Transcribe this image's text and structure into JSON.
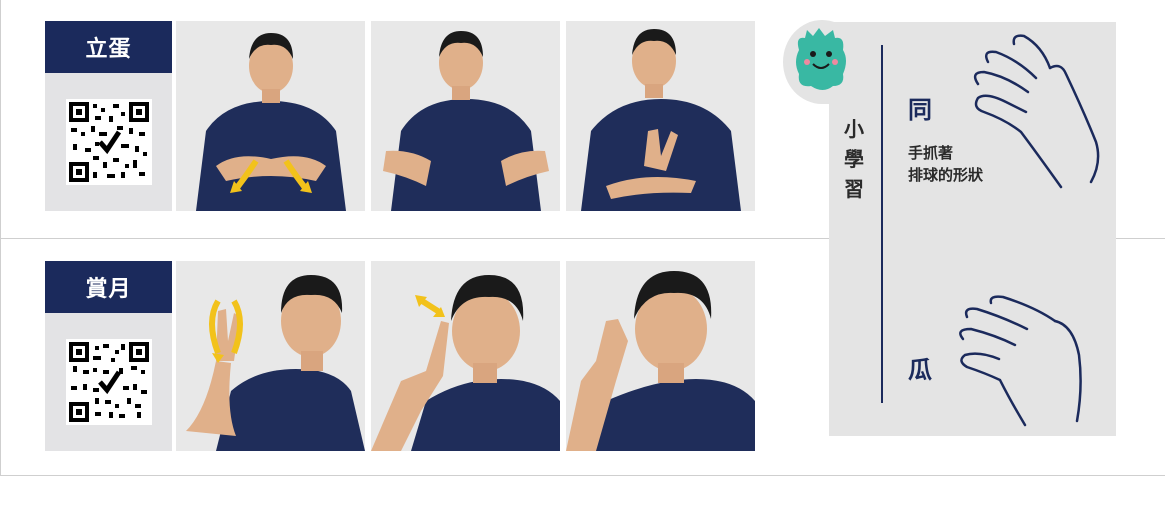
{
  "rows": [
    {
      "label": "立蛋"
    },
    {
      "label": "賞月"
    }
  ],
  "learn": {
    "title_chars": [
      "小",
      "學",
      "習"
    ],
    "item1_char": "同",
    "item1_desc_line1": "手抓著",
    "item1_desc_line2": "排球的形狀",
    "item2_char": "瓜"
  },
  "colors": {
    "navy": "#1b2a5c",
    "shirt": "#1f2d5a",
    "arrow": "#f2c21b",
    "panel": "#e4e4e4",
    "mascot": "#39b8a3"
  }
}
